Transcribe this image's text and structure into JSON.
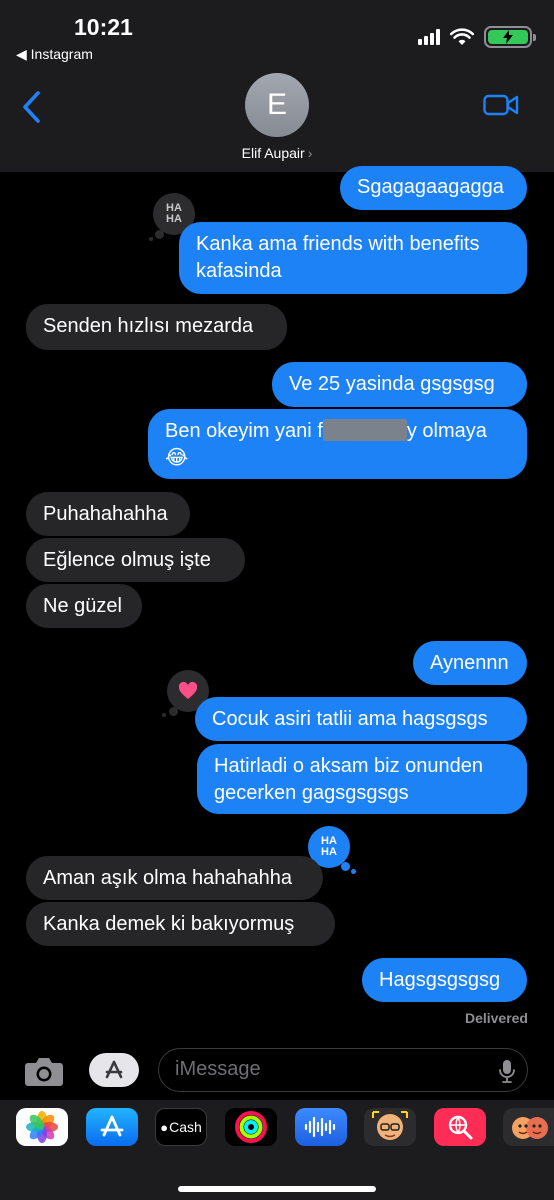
{
  "status_bar": {
    "time": "10:21",
    "back_app": "◀ Instagram"
  },
  "contact": {
    "initial": "E",
    "name": "Elif Aupair",
    "chevron": "›"
  },
  "messages": [
    {
      "dir": "sent",
      "text": "Sgagagaagagga"
    },
    {
      "dir": "sent",
      "text": "Kanka ama friends with benefits kafasinda",
      "line1": "Kanka ama friends with benefits",
      "line2": "kafasinda",
      "tapback": "HA HA"
    },
    {
      "dir": "recv",
      "text": "Senden hızlısı mezarda"
    },
    {
      "dir": "sent",
      "text": "Ve 25 yasinda gsgsgsg"
    },
    {
      "dir": "sent",
      "line1_before": "Ben okeyim yani f",
      "line1_after": "y olmaya",
      "line2": "😂"
    },
    {
      "dir": "recv",
      "text": "Puhahahahha"
    },
    {
      "dir": "recv",
      "text": "Eğlence olmuş işte"
    },
    {
      "dir": "recv",
      "text": "Ne güzel"
    },
    {
      "dir": "sent",
      "text": "Aynennn"
    },
    {
      "dir": "sent",
      "text": "Cocuk asiri tatlii ama hagsgsgs",
      "tapback": "heart"
    },
    {
      "dir": "sent",
      "line1": "Hatirladi o aksam biz onunden",
      "line2": "gecerken gagsgsgsgs"
    },
    {
      "dir": "recv",
      "text": "Aman aşık olma hahahahha",
      "tapback": "HA HA"
    },
    {
      "dir": "recv",
      "text": "Kanka demek ki bakıyormuş"
    },
    {
      "dir": "sent",
      "text": "Hagsgsgsgsg"
    }
  ],
  "tapback_text": {
    "line1": "HA",
    "line2": "HA"
  },
  "delivered": "Delivered",
  "input": {
    "placeholder": "iMessage"
  },
  "apps": [
    {
      "name": "Photos",
      "icon": "photos-icon"
    },
    {
      "name": "App Store",
      "icon": "appstore-icon"
    },
    {
      "name": "Cash",
      "label": "Cash",
      "icon": "apple-cash-icon"
    },
    {
      "name": "Activity",
      "icon": "activity-icon"
    },
    {
      "name": "Audio",
      "icon": "audio-waveform-icon"
    },
    {
      "name": "Memoji",
      "icon": "memoji-icon"
    },
    {
      "name": "Search",
      "icon": "web-search-icon"
    },
    {
      "name": "Memoji Stickers",
      "icon": "memoji-stickers-icon"
    }
  ],
  "colors": {
    "sent": "#1e82f7",
    "received": "#262628",
    "background": "#000000",
    "header": "#1c1c1e"
  }
}
